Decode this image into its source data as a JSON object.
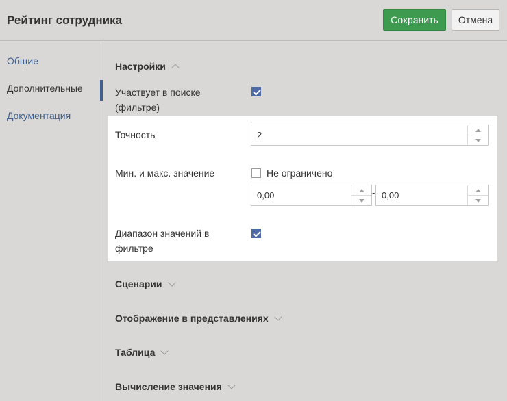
{
  "header": {
    "title": "Рейтинг сотрудника",
    "save_label": "Сохранить",
    "cancel_label": "Отмена"
  },
  "sidebar": {
    "items": [
      {
        "label": "Общие"
      },
      {
        "label": "Дополнительные"
      },
      {
        "label": "Документация"
      }
    ]
  },
  "settings": {
    "section_title": "Настройки",
    "participates_label": "Участвует в поиске (фильтре)",
    "participates_checked": true,
    "precision_label": "Точность",
    "precision_value": "2",
    "minmax_label": "Мин. и макс. значение",
    "unlimited_label": "Не ограничено",
    "unlimited_checked": false,
    "min_value": "0,00",
    "max_value": "0,00",
    "range_filter_label": "Диапазон значений в фильтре",
    "range_filter_checked": true
  },
  "sections": [
    {
      "title": "Сценарии"
    },
    {
      "title": "Отображение в представлениях"
    },
    {
      "title": "Таблица"
    },
    {
      "title": "Вычисление значения"
    }
  ],
  "colors": {
    "save_button": "#3d9a4e",
    "link": "#3e5f8f",
    "checkbox_checked": "#4d6aa7"
  }
}
